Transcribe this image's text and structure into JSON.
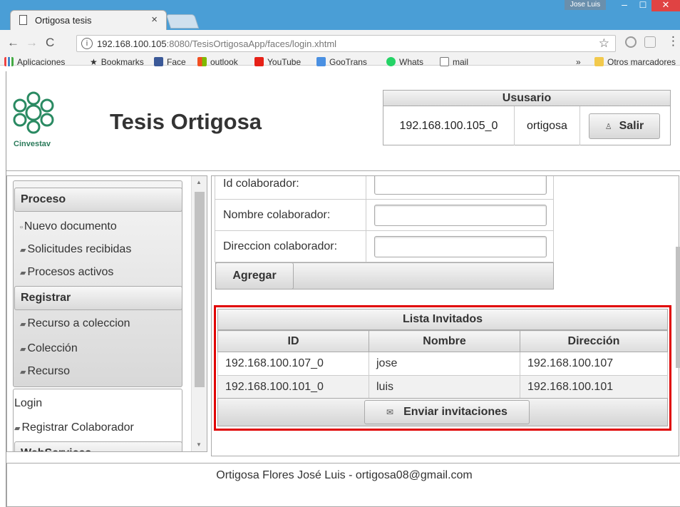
{
  "browser": {
    "tab_title": "Ortigosa tesis",
    "tab_close": "×",
    "window_user": "Jose Luis",
    "url_host": "192.168.100.105",
    "url_path": ":8080/TesisOrtigosaApp/faces/login.xhtml",
    "bookmarks": [
      "Aplicaciones",
      "Bookmarks",
      "Face",
      "outlook",
      "YouTube",
      "GooTrans",
      "Whats",
      "mail"
    ],
    "bookmarks_overflow": "»",
    "other_bookmarks": "Otros marcadores"
  },
  "header": {
    "logo_text": "Cinvestav",
    "title": "Tesis Ortigosa",
    "user_panel": {
      "title": "Ususario",
      "ip": "192.168.100.105_0",
      "username": "ortigosa",
      "logout_label": "Salir"
    }
  },
  "sidebar": {
    "groups": [
      {
        "title": "Proceso",
        "items": [
          "Nuevo documento",
          "Solicitudes recibidas",
          "Procesos activos"
        ]
      },
      {
        "title": "Registrar",
        "items": [
          "Recurso a coleccion",
          "Colección",
          "Recurso"
        ]
      },
      {
        "title": "WebServices"
      }
    ],
    "plain_items": [
      "Login",
      "Registrar Colaborador"
    ]
  },
  "form": {
    "fields": [
      {
        "label": "Id colaborador:",
        "value": ""
      },
      {
        "label": "Nombre colaborador:",
        "value": ""
      },
      {
        "label": "Direccion colaborador:",
        "value": ""
      }
    ],
    "add_label": "Agregar"
  },
  "invited": {
    "title": "Lista Invitados",
    "columns": [
      "ID",
      "Nombre",
      "Dirección"
    ],
    "rows": [
      [
        "192.168.100.107_0",
        "jose",
        "192.168.100.107"
      ],
      [
        "192.168.100.101_0",
        "luis",
        "192.168.100.101"
      ]
    ],
    "send_label": "Enviar invitaciones"
  },
  "footer": {
    "text": "Ortigosa Flores José Luis - ortigosa08@gmail.com"
  }
}
